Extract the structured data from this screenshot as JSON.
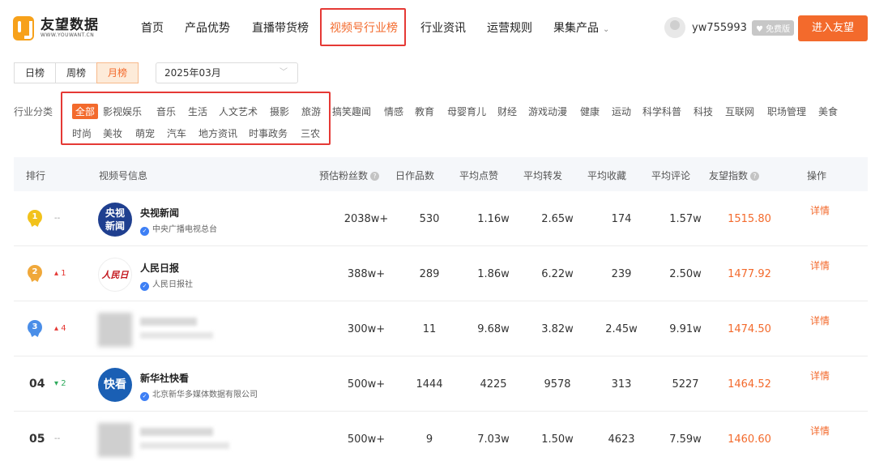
{
  "brand": {
    "name_cn": "友望数据",
    "name_en": "WWW.YOUWANT.CN"
  },
  "nav": {
    "items": [
      "首页",
      "产品优势",
      "直播带货榜",
      "视频号行业榜",
      "行业资讯",
      "运营规则",
      "果集产品"
    ],
    "active_index": 3,
    "dropdown_icon": "chevron-down-icon"
  },
  "user": {
    "name": "yw755993",
    "badge": "免费版",
    "enter_label": "进入友望"
  },
  "period_tabs": {
    "items": [
      "日榜",
      "周榜",
      "月榜"
    ],
    "active_index": 2
  },
  "month_select": {
    "value": "2025年03月"
  },
  "categories": {
    "label": "行业分类",
    "row1": [
      "全部",
      "影视娱乐",
      "音乐",
      "生活",
      "人文艺术",
      "摄影",
      "旅游",
      "搞笑趣闻",
      "情感",
      "教育",
      "母婴育儿",
      "财经",
      "游戏动漫",
      "健康",
      "运动",
      "科学科普",
      "科技",
      "互联网",
      "职场管理",
      "美食"
    ],
    "row2": [
      "时尚",
      "美妆",
      "萌宠",
      "汽车",
      "地方资讯",
      "时事政务",
      "三农"
    ],
    "active": "全部"
  },
  "table": {
    "headers": [
      "排行",
      "视频号信息",
      "预估粉丝数",
      "日作品数",
      "平均点赞",
      "平均转发",
      "平均收藏",
      "平均评论",
      "友望指数",
      "操作"
    ],
    "detail_label": "详情",
    "rows": [
      {
        "rank": "1",
        "change": "--",
        "name": "央视新闻",
        "org": "中央广播电视总台",
        "fans": "2038w+",
        "works": "530",
        "likes": "1.16w",
        "shares": "2.65w",
        "collects": "174",
        "comments": "1.57w",
        "index": "1515.80"
      },
      {
        "rank": "2",
        "change": "1",
        "name": "人民日报",
        "org": "人民日报社",
        "fans": "388w+",
        "works": "289",
        "likes": "1.86w",
        "shares": "6.22w",
        "collects": "239",
        "comments": "2.50w",
        "index": "1477.92"
      },
      {
        "rank": "3",
        "change": "4",
        "name": "",
        "org": "",
        "fans": "300w+",
        "works": "11",
        "likes": "9.68w",
        "shares": "3.82w",
        "collects": "2.45w",
        "comments": "9.91w",
        "index": "1474.50"
      },
      {
        "rank": "04",
        "change": "2",
        "name": "新华社快看",
        "org": "北京新华多媒体数据有限公司",
        "fans": "500w+",
        "works": "1444",
        "likes": "4225",
        "shares": "9578",
        "collects": "313",
        "comments": "5227",
        "index": "1464.52"
      },
      {
        "rank": "05",
        "change": "--",
        "name": "",
        "org": "",
        "fans": "500w+",
        "works": "9",
        "likes": "7.03w",
        "shares": "1.50w",
        "collects": "4623",
        "comments": "7.59w",
        "index": "1460.60"
      }
    ]
  },
  "colors": {
    "accent": "#f36a2c",
    "highlight_box": "#e53935",
    "gold": "#f2c21b",
    "silver": "#f0a83a",
    "bronze": "#4a8ee8"
  }
}
